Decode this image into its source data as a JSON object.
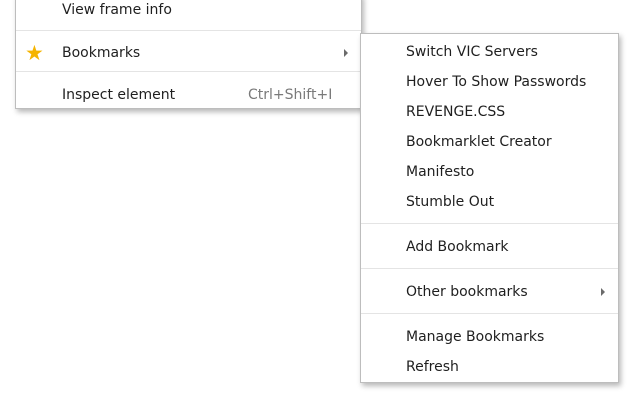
{
  "main_menu": {
    "items": [
      {
        "label": "View frame info"
      },
      {
        "label": "Bookmarks",
        "icon": "star-icon",
        "icon_color": "#f5b400"
      },
      {
        "label": "Inspect element",
        "shortcut": "Ctrl+Shift+I"
      }
    ]
  },
  "bookmarks_submenu": {
    "items": [
      {
        "label": "Switch VIC Servers"
      },
      {
        "label": "Hover To Show Passwords"
      },
      {
        "label": "REVENGE.CSS"
      },
      {
        "label": "Bookmarklet Creator"
      },
      {
        "label": "Manifesto"
      },
      {
        "label": "Stumble Out"
      },
      {
        "label": "Add Bookmark"
      },
      {
        "label": "Other bookmarks"
      },
      {
        "label": "Manage Bookmarks"
      },
      {
        "label": "Refresh"
      }
    ]
  }
}
